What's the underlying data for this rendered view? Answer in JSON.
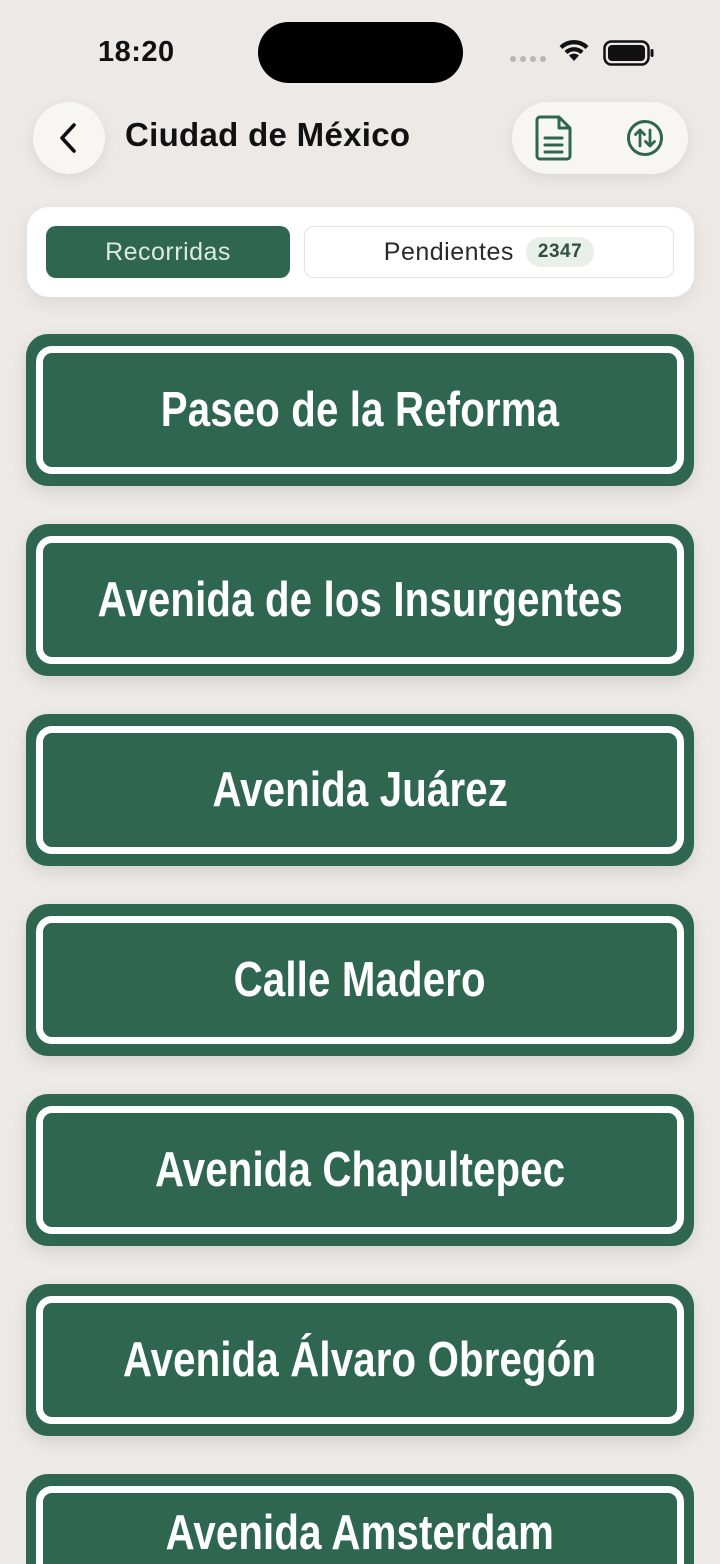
{
  "status_bar": {
    "time": "18:20"
  },
  "header": {
    "title": "Ciudad de México"
  },
  "segments": {
    "active_label": "Recorridas",
    "inactive_label": "Pendientes",
    "pending_count": "2347"
  },
  "streets": [
    {
      "name": "Paseo de la Reforma"
    },
    {
      "name": "Avenida de los Insurgentes"
    },
    {
      "name": "Avenida Juárez"
    },
    {
      "name": "Calle Madero"
    },
    {
      "name": "Avenida Chapultepec"
    },
    {
      "name": "Avenida Álvaro Obregón"
    },
    {
      "name": "Avenida Amsterdam"
    }
  ],
  "colors": {
    "sign_green": "#2E6650",
    "background": "#ECE9E6",
    "surface": "#FFFFFF"
  },
  "icons": {
    "back": "chevron-left-icon",
    "document": "document-icon",
    "sort": "sort-arrows-icon"
  }
}
